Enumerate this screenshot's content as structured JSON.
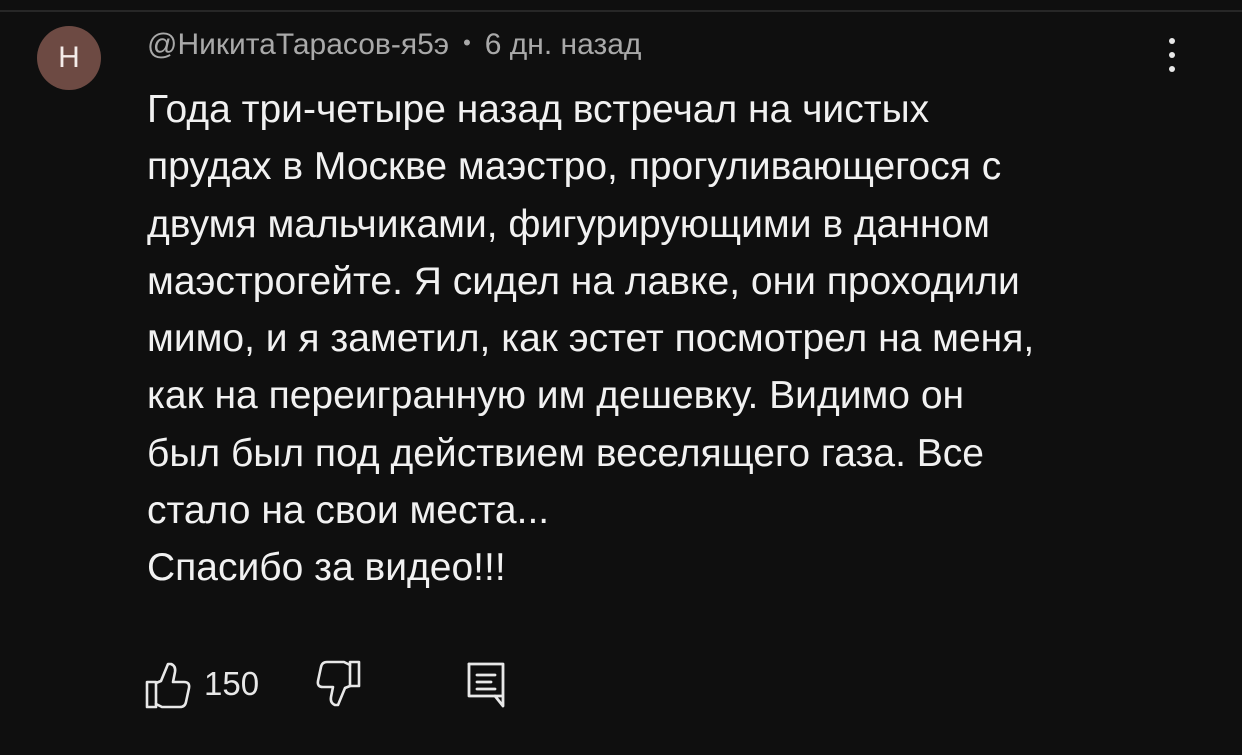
{
  "comment": {
    "avatar_letter": "Н",
    "author": "@НикитаТарасов-я5э",
    "separator": "•",
    "time": "6 дн. назад",
    "lines": [
      "Года три-четыре назад встречал на чистых",
      "прудах в Москве маэстро, прогуливающегося с",
      "двумя мальчиками, фигурирующими в данном",
      "маэстрогейте. Я сидел на лавке, они проходили",
      "мимо, и я заметил, как эстет посмотрел на меня,",
      "как на переигранную им дешевку. Видимо он",
      "был был под действием веселящего газа. Все",
      "стало на свои места...",
      "Спасибо за видео!!!"
    ],
    "like_count": "150",
    "icons": {
      "like": "thumbs-up-icon",
      "dislike": "thumbs-down-icon",
      "reply": "reply-comment-icon",
      "menu": "more-vertical-icon"
    },
    "colors": {
      "background": "#0f0f0f",
      "avatar": "#6d4a43",
      "meta_text": "#a9a9a9",
      "body_text": "#f1f1f1"
    }
  }
}
